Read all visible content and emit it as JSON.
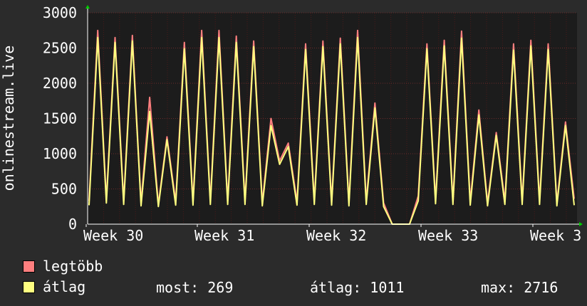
{
  "chart_data": {
    "type": "area",
    "ylabel": "onlinestream.live",
    "ylim": [
      0,
      3000
    ],
    "yticks": [
      0,
      500,
      1000,
      1500,
      2000,
      2500,
      3000
    ],
    "xtick_labels": [
      "Week 30",
      "Week 31",
      "Week 32",
      "Week 33",
      "Week 3"
    ],
    "grid": true,
    "series": [
      {
        "name": "legtöbb",
        "color": "#ff7f7f",
        "values": [
          330,
          2750,
          350,
          2650,
          330,
          2680,
          300,
          1800,
          280,
          1240,
          320,
          2580,
          320,
          2750,
          330,
          2750,
          330,
          2670,
          330,
          2600,
          300,
          1500,
          900,
          1150,
          320,
          2560,
          330,
          2600,
          320,
          2640,
          310,
          2750,
          330,
          1720,
          300,
          0,
          0,
          0,
          400,
          2560,
          340,
          2610,
          330,
          2740,
          320,
          1620,
          300,
          1300,
          330,
          2560,
          330,
          2610,
          330,
          2560,
          300,
          1450,
          360
        ]
      },
      {
        "name": "átlag",
        "color": "#ffff80",
        "values": [
          269,
          2650,
          300,
          2580,
          280,
          2600,
          260,
          1600,
          250,
          1200,
          270,
          2490,
          270,
          2650,
          280,
          2650,
          280,
          2580,
          280,
          2520,
          260,
          1400,
          850,
          1100,
          270,
          2480,
          280,
          2520,
          270,
          2560,
          260,
          2650,
          280,
          1650,
          250,
          0,
          0,
          0,
          330,
          2490,
          290,
          2530,
          280,
          2640,
          270,
          1550,
          260,
          1260,
          280,
          2470,
          280,
          2530,
          280,
          2480,
          260,
          1400,
          269
        ]
      }
    ]
  },
  "legend": {
    "items": [
      {
        "label": "legtöbb",
        "color": "#ff7f7f"
      },
      {
        "label": "átlag",
        "color": "#ffff80"
      }
    ],
    "now_label": "most: 269",
    "avg_label": "átlag: 1011",
    "max_label": "max: 2716"
  },
  "colors": {
    "background": "#2b2b2b",
    "plot_background": "#1c1c1c",
    "grid": "#4a1a1a",
    "axis": "#ffffff",
    "arrow": "#00cc00"
  }
}
